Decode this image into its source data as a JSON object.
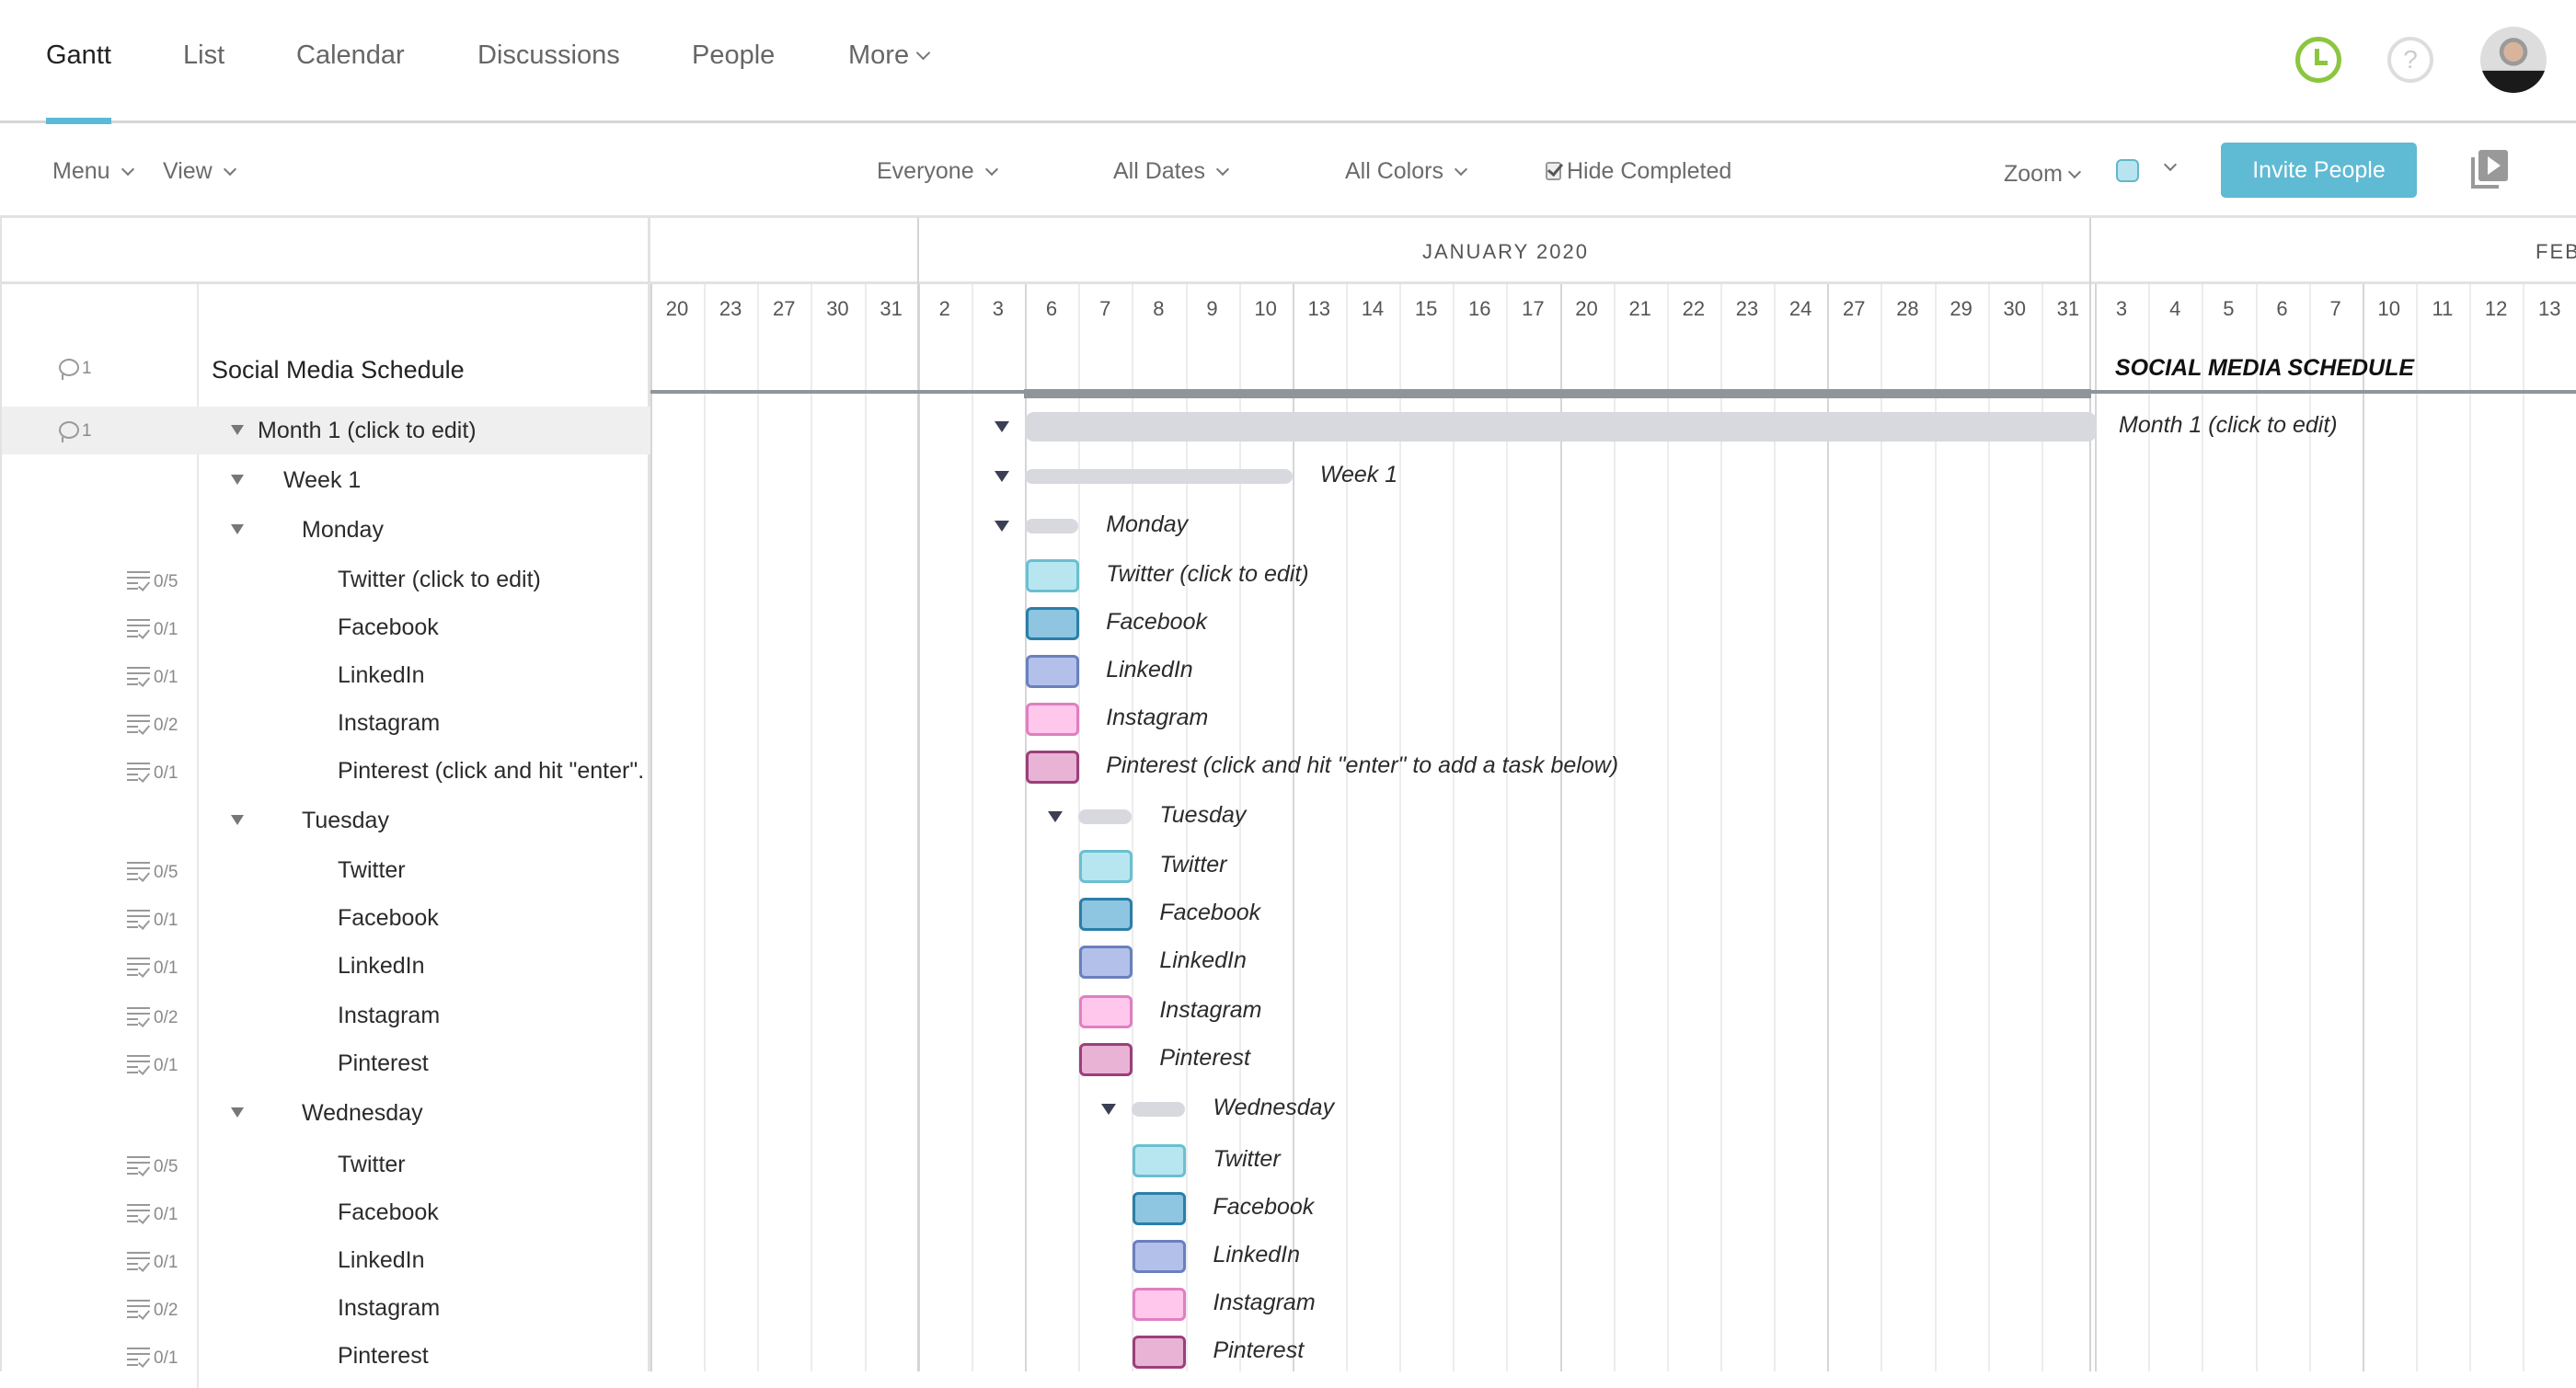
{
  "nav": {
    "tabs": [
      "Gantt",
      "List",
      "Calendar",
      "Discussions",
      "People",
      "More"
    ],
    "active_tab": "Gantt",
    "icons": [
      "clock-icon",
      "help-icon",
      "avatar"
    ]
  },
  "toolbar": {
    "menu": "Menu",
    "view": "View",
    "everyone": "Everyone",
    "all_dates": "All Dates",
    "all_colors": "All Colors",
    "hide_completed": "Hide Completed",
    "hide_completed_checked": true,
    "zoom": "Zoom",
    "invite": "Invite People",
    "color_picker_value": "#b8e4f0"
  },
  "timeline": {
    "months": [
      {
        "label": "JANUARY 2020"
      },
      {
        "label": "FEB"
      }
    ],
    "days": [
      "20",
      "23",
      "27",
      "30",
      "31",
      "2",
      "3",
      "6",
      "7",
      "8",
      "9",
      "10",
      "13",
      "14",
      "15",
      "16",
      "17",
      "20",
      "21",
      "22",
      "23",
      "24",
      "27",
      "28",
      "29",
      "30",
      "31",
      "3",
      "4",
      "5",
      "6",
      "7",
      "10",
      "11",
      "12",
      "13"
    ]
  },
  "colors": {
    "twitter": {
      "fill": "#b8e6f0",
      "border": "#6bbfd1"
    },
    "facebook": {
      "fill": "#8ec5e0",
      "border": "#2a7fa8"
    },
    "linkedin": {
      "fill": "#b3c1ea",
      "border": "#6a80be"
    },
    "instagram": {
      "fill": "#ffc7ec",
      "border": "#e07fc2"
    },
    "pinterest": {
      "fill": "#e9b3d6",
      "border": "#9c3f7b"
    }
  },
  "project": {
    "name": "Social Media Schedule",
    "gantt_label": "SOCIAL MEDIA SCHEDULE",
    "comments": "1"
  },
  "rows": [
    {
      "type": "group",
      "level": 1,
      "label": "Month 1 (click to edit)",
      "gantt_label": "Month 1 (click to edit)",
      "comments": "1",
      "selected": true
    },
    {
      "type": "group",
      "level": 2,
      "label": "Week 1",
      "gantt_label": "Week 1"
    },
    {
      "type": "group",
      "level": 3,
      "label": "Monday",
      "gantt_label": "Monday"
    },
    {
      "type": "task",
      "label": "Twitter (click to edit)",
      "gantt_label": "Twitter (click to edit)",
      "checklist": "0/5",
      "color": "twitter"
    },
    {
      "type": "task",
      "label": "Facebook",
      "gantt_label": "Facebook",
      "checklist": "0/1",
      "color": "facebook"
    },
    {
      "type": "task",
      "label": "LinkedIn",
      "gantt_label": "LinkedIn",
      "checklist": "0/1",
      "color": "linkedin"
    },
    {
      "type": "task",
      "label": "Instagram",
      "gantt_label": "Instagram",
      "checklist": "0/2",
      "color": "instagram"
    },
    {
      "type": "task",
      "label": "Pinterest (click and hit \"enter\".",
      "gantt_label": "Pinterest (click and hit \"enter\" to add a task below)",
      "checklist": "0/1",
      "color": "pinterest"
    },
    {
      "type": "group",
      "level": 3,
      "label": "Tuesday",
      "gantt_label": "Tuesday"
    },
    {
      "type": "task",
      "label": "Twitter",
      "gantt_label": "Twitter",
      "checklist": "0/5",
      "color": "twitter"
    },
    {
      "type": "task",
      "label": "Facebook",
      "gantt_label": "Facebook",
      "checklist": "0/1",
      "color": "facebook"
    },
    {
      "type": "task",
      "label": "LinkedIn",
      "gantt_label": "LinkedIn",
      "checklist": "0/1",
      "color": "linkedin"
    },
    {
      "type": "task",
      "label": "Instagram",
      "gantt_label": "Instagram",
      "checklist": "0/2",
      "color": "instagram"
    },
    {
      "type": "task",
      "label": "Pinterest",
      "gantt_label": "Pinterest",
      "checklist": "0/1",
      "color": "pinterest"
    },
    {
      "type": "group",
      "level": 3,
      "label": "Wednesday",
      "gantt_label": "Wednesday"
    },
    {
      "type": "task",
      "label": "Twitter",
      "gantt_label": "Twitter",
      "checklist": "0/5",
      "color": "twitter"
    },
    {
      "type": "task",
      "label": "Facebook",
      "gantt_label": "Facebook",
      "checklist": "0/1",
      "color": "facebook"
    },
    {
      "type": "task",
      "label": "LinkedIn",
      "gantt_label": "LinkedIn",
      "checklist": "0/1",
      "color": "linkedin"
    },
    {
      "type": "task",
      "label": "Instagram",
      "gantt_label": "Instagram",
      "checklist": "0/2",
      "color": "instagram"
    },
    {
      "type": "task",
      "label": "Pinterest",
      "gantt_label": "Pinterest",
      "checklist": "0/1",
      "color": "pinterest"
    }
  ]
}
